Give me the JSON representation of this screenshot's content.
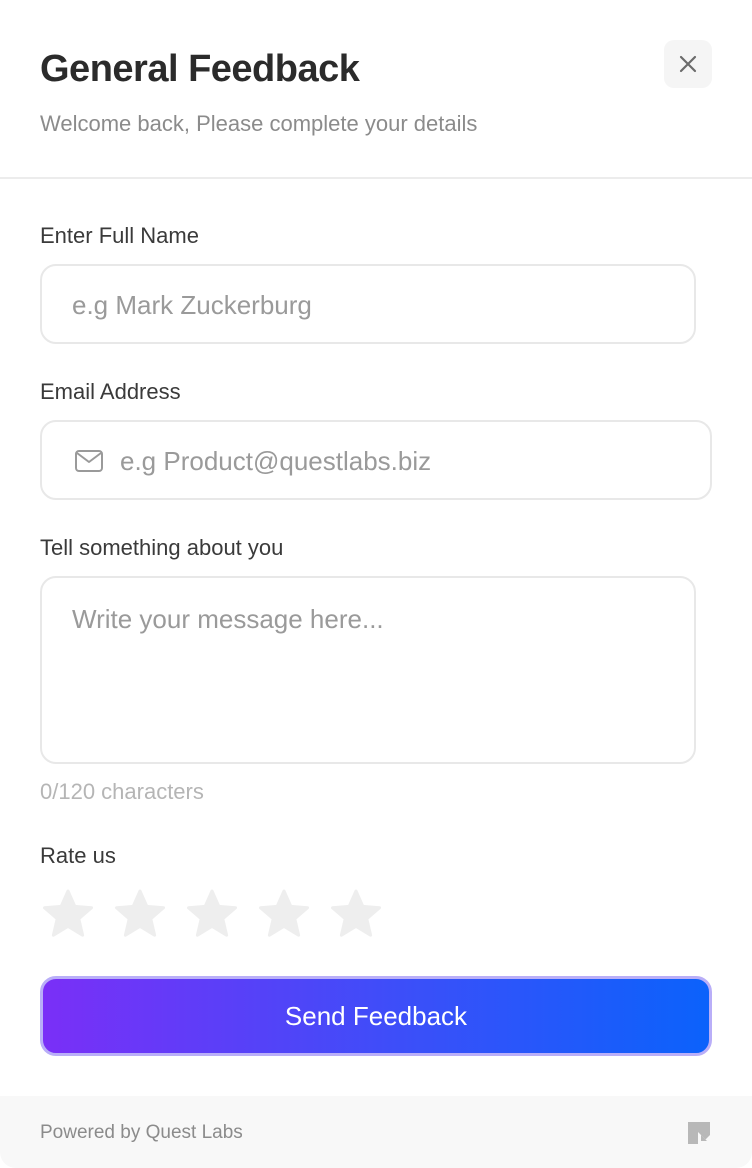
{
  "header": {
    "title": "General Feedback",
    "subtitle": "Welcome back, Please complete your details",
    "close_icon": "close-icon"
  },
  "form": {
    "name": {
      "label": "Enter Full Name",
      "placeholder": "e.g Mark Zuckerburg",
      "value": ""
    },
    "email": {
      "label": "Email Address",
      "placeholder": "e.g Product@questlabs.biz",
      "value": "",
      "icon": "mail-icon"
    },
    "message": {
      "label": "Tell something about you",
      "placeholder": "Write your message here...",
      "value": "",
      "char_count": "0/120 characters"
    },
    "rating": {
      "label": "Rate us",
      "max": 5,
      "value": 0,
      "icon": "star-icon"
    },
    "submit_label": "Send Feedback"
  },
  "footer": {
    "powered_by": "Powered by Quest Labs",
    "logo_icon": "quest-logo-icon"
  },
  "colors": {
    "gradient_start": "#7a2ff7",
    "gradient_end": "#0b62fb",
    "star_empty": "#eeeeee",
    "title": "#2b2b2b"
  }
}
